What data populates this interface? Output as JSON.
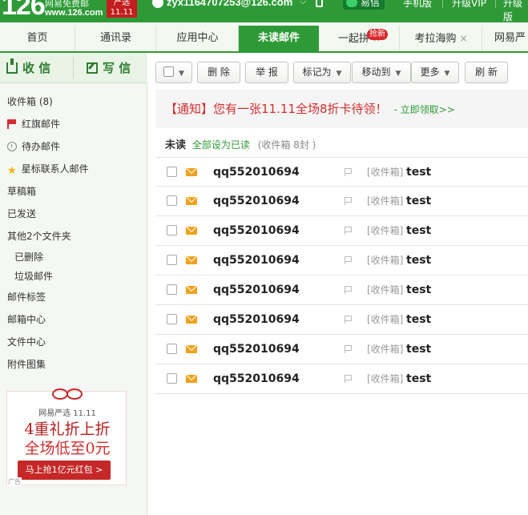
{
  "header": {
    "logo_number": "126",
    "logo_name": "网易免费邮",
    "logo_url": "www.126.com",
    "promo_badge": "严选 11.11",
    "user_email": "zyx1164707253@126.com",
    "yixin_label": "易信",
    "links": [
      "手机版",
      "升级VIP",
      "升级版"
    ]
  },
  "tabs": [
    {
      "label": "首页"
    },
    {
      "label": "通讯录"
    },
    {
      "label": "应用中心"
    },
    {
      "label": "未读邮件"
    },
    {
      "label": "一起拼"
    },
    {
      "label": "考拉海购"
    },
    {
      "label": "网易严"
    }
  ],
  "tab_badge": "抢新",
  "tab_close_glyph": "×",
  "sidebar": {
    "receive_label": "收 信",
    "write_label": "写 信",
    "folders": [
      {
        "label": "收件箱 (8)"
      },
      {
        "label": "红旗邮件"
      },
      {
        "label": "待办邮件"
      },
      {
        "label": "星标联系人邮件"
      },
      {
        "label": "草稿箱"
      },
      {
        "label": "已发送"
      },
      {
        "label": "其他2个文件夹"
      },
      {
        "label": "已删除"
      },
      {
        "label": "垃圾邮件"
      },
      {
        "label": "邮件标签"
      },
      {
        "label": "邮箱中心"
      },
      {
        "label": "文件中心"
      },
      {
        "label": "附件图集"
      }
    ],
    "ad": {
      "brand": "网易严选 11.11",
      "line1": "4重礼折上折",
      "line2": "全场低至0元",
      "button": "马上抢1亿元红包 >",
      "tag": "广告"
    }
  },
  "toolbar": {
    "delete": "删 除",
    "report": "举 报",
    "mark_as": "标记为",
    "move_to": "移动到",
    "more": "更多",
    "refresh": "刷 新"
  },
  "notice": {
    "text": "【通知】您有一张11.11全场8折卡待领！",
    "link": "- 立即领取>>"
  },
  "summary": {
    "title": "未读",
    "mark_all": "全部设为已读",
    "count": "(收件箱 8封 )"
  },
  "emails": [
    {
      "sender": "qq552010694",
      "folder": "[收件箱]",
      "subject": "test"
    },
    {
      "sender": "qq552010694",
      "folder": "[收件箱]",
      "subject": "test"
    },
    {
      "sender": "qq552010694",
      "folder": "[收件箱]",
      "subject": "test"
    },
    {
      "sender": "qq552010694",
      "folder": "[收件箱]",
      "subject": "test"
    },
    {
      "sender": "qq552010694",
      "folder": "[收件箱]",
      "subject": "test"
    },
    {
      "sender": "qq552010694",
      "folder": "[收件箱]",
      "subject": "test"
    },
    {
      "sender": "qq552010694",
      "folder": "[收件箱]",
      "subject": "test"
    },
    {
      "sender": "qq552010694",
      "folder": "[收件箱]",
      "subject": "test"
    }
  ],
  "colors": {
    "brand_green": "#2e9a37",
    "notice_red": "#d32f2f",
    "envelope": "#f0a21b"
  }
}
